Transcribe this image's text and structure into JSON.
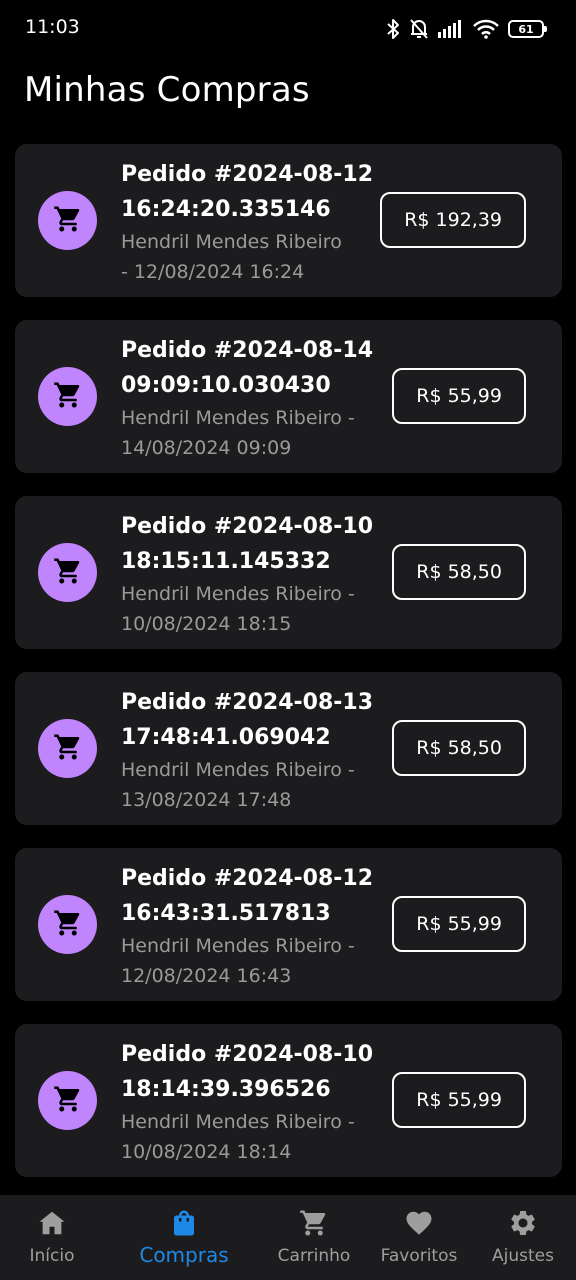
{
  "status_bar": {
    "time": "11:03",
    "battery_level": "61",
    "icons": [
      "bluetooth-icon",
      "bell-off-icon",
      "signal-icon",
      "wifi-icon",
      "battery-icon"
    ]
  },
  "header": {
    "title": "Minhas Compras"
  },
  "orders": [
    {
      "title_line1": "Pedido #2024-08-12",
      "title_line2": "16:24:20.335146",
      "sub_line1": "Hendril Mendes Ribeiro",
      "sub_line2": "- 12/08/2024 16:24",
      "price": "R$ 192,39"
    },
    {
      "title_line1": "Pedido #2024-08-14",
      "title_line2": "09:09:10.030430",
      "sub_line1": "Hendril Mendes Ribeiro -",
      "sub_line2": "14/08/2024 09:09",
      "price": "R$ 55,99"
    },
    {
      "title_line1": "Pedido #2024-08-10",
      "title_line2": "18:15:11.145332",
      "sub_line1": "Hendril Mendes Ribeiro -",
      "sub_line2": "10/08/2024 18:15",
      "price": "R$ 58,50"
    },
    {
      "title_line1": "Pedido #2024-08-13",
      "title_line2": "17:48:41.069042",
      "sub_line1": "Hendril Mendes Ribeiro -",
      "sub_line2": "13/08/2024 17:48",
      "price": "R$ 58,50"
    },
    {
      "title_line1": "Pedido #2024-08-12",
      "title_line2": "16:43:31.517813",
      "sub_line1": "Hendril Mendes Ribeiro -",
      "sub_line2": "12/08/2024 16:43",
      "price": "R$ 55,99"
    },
    {
      "title_line1": "Pedido #2024-08-10",
      "title_line2": "18:14:39.396526",
      "sub_line1": "Hendril Mendes Ribeiro -",
      "sub_line2": "10/08/2024 18:14",
      "price": "R$ 55,99"
    }
  ],
  "order_icon": "shopping-cart-icon",
  "bottom_nav": {
    "items": [
      {
        "label": "Início",
        "icon": "home-icon",
        "active": false
      },
      {
        "label": "Compras",
        "icon": "shopping-bag-icon",
        "active": true
      },
      {
        "label": "Carrinho",
        "icon": "shopping-cart-icon",
        "active": false
      },
      {
        "label": "Favoritos",
        "icon": "heart-icon",
        "active": false
      },
      {
        "label": "Ajustes",
        "icon": "gear-icon",
        "active": false
      }
    ]
  },
  "colors": {
    "background": "#000000",
    "card": "#1c1c1e",
    "avatar": "#c084fc",
    "accent": "#1e88e5",
    "muted_text": "#9a9a9a"
  }
}
